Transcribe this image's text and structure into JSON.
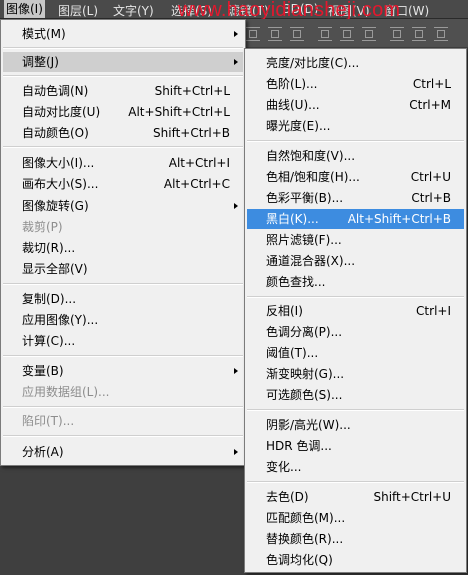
{
  "menubar": {
    "items": [
      {
        "label": "图像(I)"
      },
      {
        "label": "图层(L)"
      },
      {
        "label": "文字(Y)"
      },
      {
        "label": "选择(S)"
      },
      {
        "label": "滤镜(T)"
      },
      {
        "label": "3D(D)"
      },
      {
        "label": "视图(V)"
      },
      {
        "label": "窗口(W)"
      }
    ],
    "watermark": "www.haoyidiansheji.com"
  },
  "main_menu": {
    "items": [
      {
        "label": "模式(M)",
        "shortcut": ""
      },
      {
        "label": "调整(J)",
        "shortcut": ""
      },
      {
        "label": "自动色调(N)",
        "shortcut": "Shift+Ctrl+L"
      },
      {
        "label": "自动对比度(U)",
        "shortcut": "Alt+Shift+Ctrl+L"
      },
      {
        "label": "自动颜色(O)",
        "shortcut": "Shift+Ctrl+B"
      },
      {
        "label": "图像大小(I)...",
        "shortcut": "Alt+Ctrl+I"
      },
      {
        "label": "画布大小(S)...",
        "shortcut": "Alt+Ctrl+C"
      },
      {
        "label": "图像旋转(G)",
        "shortcut": ""
      },
      {
        "label": "裁剪(P)",
        "shortcut": ""
      },
      {
        "label": "裁切(R)...",
        "shortcut": ""
      },
      {
        "label": "显示全部(V)",
        "shortcut": ""
      },
      {
        "label": "复制(D)...",
        "shortcut": ""
      },
      {
        "label": "应用图像(Y)...",
        "shortcut": ""
      },
      {
        "label": "计算(C)...",
        "shortcut": ""
      },
      {
        "label": "变量(B)",
        "shortcut": ""
      },
      {
        "label": "应用数据组(L)...",
        "shortcut": ""
      },
      {
        "label": "陷印(T)...",
        "shortcut": ""
      },
      {
        "label": "分析(A)",
        "shortcut": ""
      }
    ]
  },
  "adjust_submenu": {
    "items": [
      {
        "label": "亮度/对比度(C)...",
        "shortcut": ""
      },
      {
        "label": "色阶(L)...",
        "shortcut": "Ctrl+L"
      },
      {
        "label": "曲线(U)...",
        "shortcut": "Ctrl+M"
      },
      {
        "label": "曝光度(E)...",
        "shortcut": ""
      },
      {
        "label": "自然饱和度(V)...",
        "shortcut": ""
      },
      {
        "label": "色相/饱和度(H)...",
        "shortcut": "Ctrl+U"
      },
      {
        "label": "色彩平衡(B)...",
        "shortcut": "Ctrl+B"
      },
      {
        "label": "黑白(K)...",
        "shortcut": "Alt+Shift+Ctrl+B"
      },
      {
        "label": "照片滤镜(F)...",
        "shortcut": ""
      },
      {
        "label": "通道混合器(X)...",
        "shortcut": ""
      },
      {
        "label": "颜色查找...",
        "shortcut": ""
      },
      {
        "label": "反相(I)",
        "shortcut": "Ctrl+I"
      },
      {
        "label": "色调分离(P)...",
        "shortcut": ""
      },
      {
        "label": "阈值(T)...",
        "shortcut": ""
      },
      {
        "label": "渐变映射(G)...",
        "shortcut": ""
      },
      {
        "label": "可选颜色(S)...",
        "shortcut": ""
      },
      {
        "label": "阴影/高光(W)...",
        "shortcut": ""
      },
      {
        "label": "HDR 色调...",
        "shortcut": ""
      },
      {
        "label": "变化...",
        "shortcut": ""
      },
      {
        "label": "去色(D)",
        "shortcut": "Shift+Ctrl+U"
      },
      {
        "label": "匹配颜色(M)...",
        "shortcut": ""
      },
      {
        "label": "替换颜色(R)...",
        "shortcut": ""
      },
      {
        "label": "色调均化(Q)",
        "shortcut": ""
      }
    ]
  },
  "colors": {
    "highlight": "#3d8ce0",
    "watermark": "#e4172d",
    "menu_bg": "#f0f0f0"
  }
}
